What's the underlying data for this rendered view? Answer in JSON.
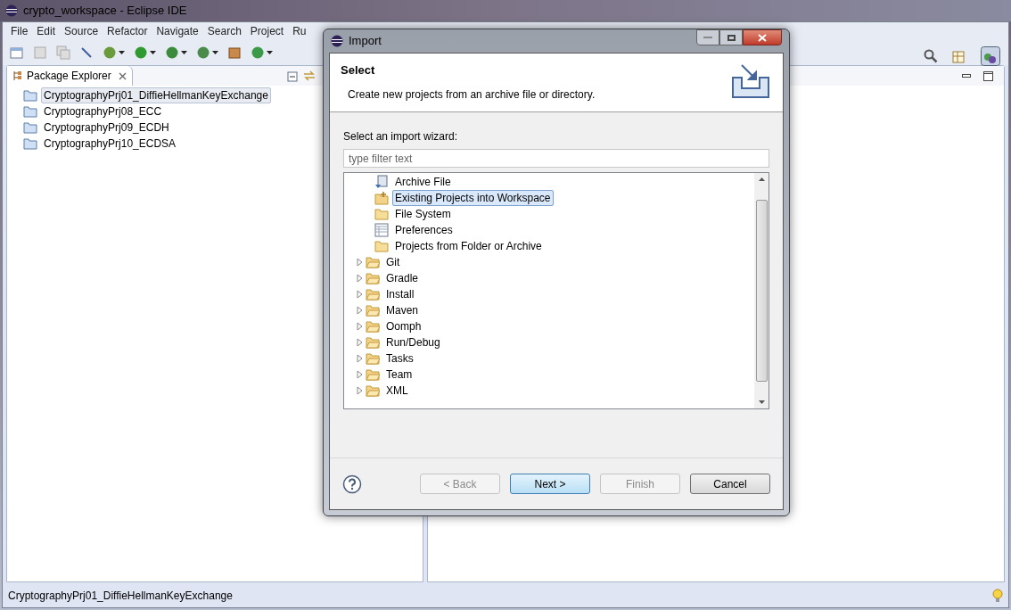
{
  "window": {
    "title": "crypto_workspace - Eclipse IDE"
  },
  "menu": [
    "File",
    "Edit",
    "Source",
    "Refactor",
    "Navigate",
    "Search",
    "Project",
    "Ru"
  ],
  "package_explorer": {
    "title": "Package Explorer",
    "projects": [
      {
        "label": "CryptographyPrj01_DiffieHellmanKeyExchange",
        "selected": true
      },
      {
        "label": "CryptographyPrj08_ECC",
        "selected": false
      },
      {
        "label": "CryptographyPrj09_ECDH",
        "selected": false
      },
      {
        "label": "CryptographyPrj10_ECDSA",
        "selected": false
      }
    ]
  },
  "dialog": {
    "title": "Import",
    "heading": "Select",
    "description": "Create new projects from an archive file or directory.",
    "wizard_label": "Select an import wizard:",
    "filter": {
      "placeholder": "type filter text"
    },
    "wizards": [
      {
        "label": "Archive File",
        "kind": "archive",
        "selected": false
      },
      {
        "label": "Existing Projects into Workspace",
        "kind": "project",
        "selected": true
      },
      {
        "label": "File System",
        "kind": "folder",
        "selected": false
      },
      {
        "label": "Preferences",
        "kind": "preferences",
        "selected": false
      },
      {
        "label": "Projects from Folder or Archive",
        "kind": "folder",
        "selected": false
      },
      {
        "label": "Git",
        "kind": "category",
        "expanded": false,
        "selected": false
      },
      {
        "label": "Gradle",
        "kind": "category",
        "expanded": false,
        "selected": false
      },
      {
        "label": "Install",
        "kind": "category",
        "expanded": false,
        "selected": false
      },
      {
        "label": "Maven",
        "kind": "category",
        "expanded": false,
        "selected": false
      },
      {
        "label": "Oomph",
        "kind": "category",
        "expanded": false,
        "selected": false
      },
      {
        "label": "Run/Debug",
        "kind": "category",
        "expanded": false,
        "selected": false
      },
      {
        "label": "Tasks",
        "kind": "category",
        "expanded": false,
        "selected": false
      },
      {
        "label": "Team",
        "kind": "category",
        "expanded": false,
        "selected": false
      },
      {
        "label": "XML",
        "kind": "category",
        "expanded": false,
        "selected": false
      }
    ],
    "buttons": [
      {
        "label": "< Back",
        "disabled": true,
        "default": false
      },
      {
        "label": "Next >",
        "disabled": false,
        "default": true
      },
      {
        "label": "Finish",
        "disabled": true,
        "default": false
      },
      {
        "label": "Cancel",
        "disabled": false,
        "default": false
      }
    ]
  },
  "status_bar": {
    "text": "CryptographyPrj01_DiffieHellmanKeyExchange"
  }
}
